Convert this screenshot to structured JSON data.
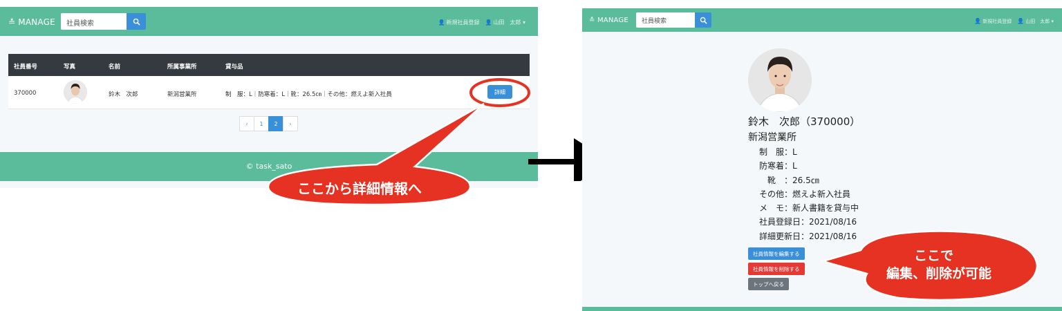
{
  "left": {
    "navbar": {
      "brand": "≛ MANAGE",
      "search_placeholder": "社員検索",
      "register_link": "新規社員登録",
      "user_menu": "山田　太郎"
    },
    "table": {
      "headers": [
        "社員番号",
        "写真",
        "名前",
        "所属事業所",
        "貸与品"
      ],
      "rows": [
        {
          "number": "370000",
          "name": "鈴木　次郎",
          "office": "新潟営業所",
          "items": "制　服：L｜防寒着：L｜靴：26.5㎝｜その他：燃えよ新入社員",
          "detail_label": "詳細"
        }
      ]
    },
    "pagination": {
      "prev": "‹",
      "pages": [
        "1",
        "2"
      ],
      "current": "2",
      "next": "›"
    },
    "footer": "© task_sato"
  },
  "right": {
    "navbar": {
      "brand": "≛ MANAGE",
      "search_placeholder": "社員検索",
      "register_link": "新規社員登録",
      "user_menu": "山田　太郎"
    },
    "profile": {
      "name_line": "鈴木　次郎（370000）",
      "office": "新潟営業所",
      "fields": [
        "制　服：L",
        "防寒着：L",
        "　靴　：26.5㎝",
        "その他：燃えよ新入社員",
        "メ　モ：新人書籍を貸与中",
        "社員登録日：2021/08/16",
        "詳細更新日：2021/08/16"
      ]
    },
    "buttons": {
      "edit": "社員情報を編集する",
      "delete": "社員情報を削除する",
      "back": "トップへ戻る"
    }
  },
  "callouts": {
    "detail": "ここから詳細情報へ",
    "edit_line1": "ここで",
    "edit_line2": "編集、削除が可能"
  },
  "colors": {
    "navbar": "#5abc9b",
    "primary": "#3a8fd9",
    "danger": "#e53935",
    "secondary": "#6c757d",
    "callout": "#e63222",
    "table_header": "#343a40"
  }
}
